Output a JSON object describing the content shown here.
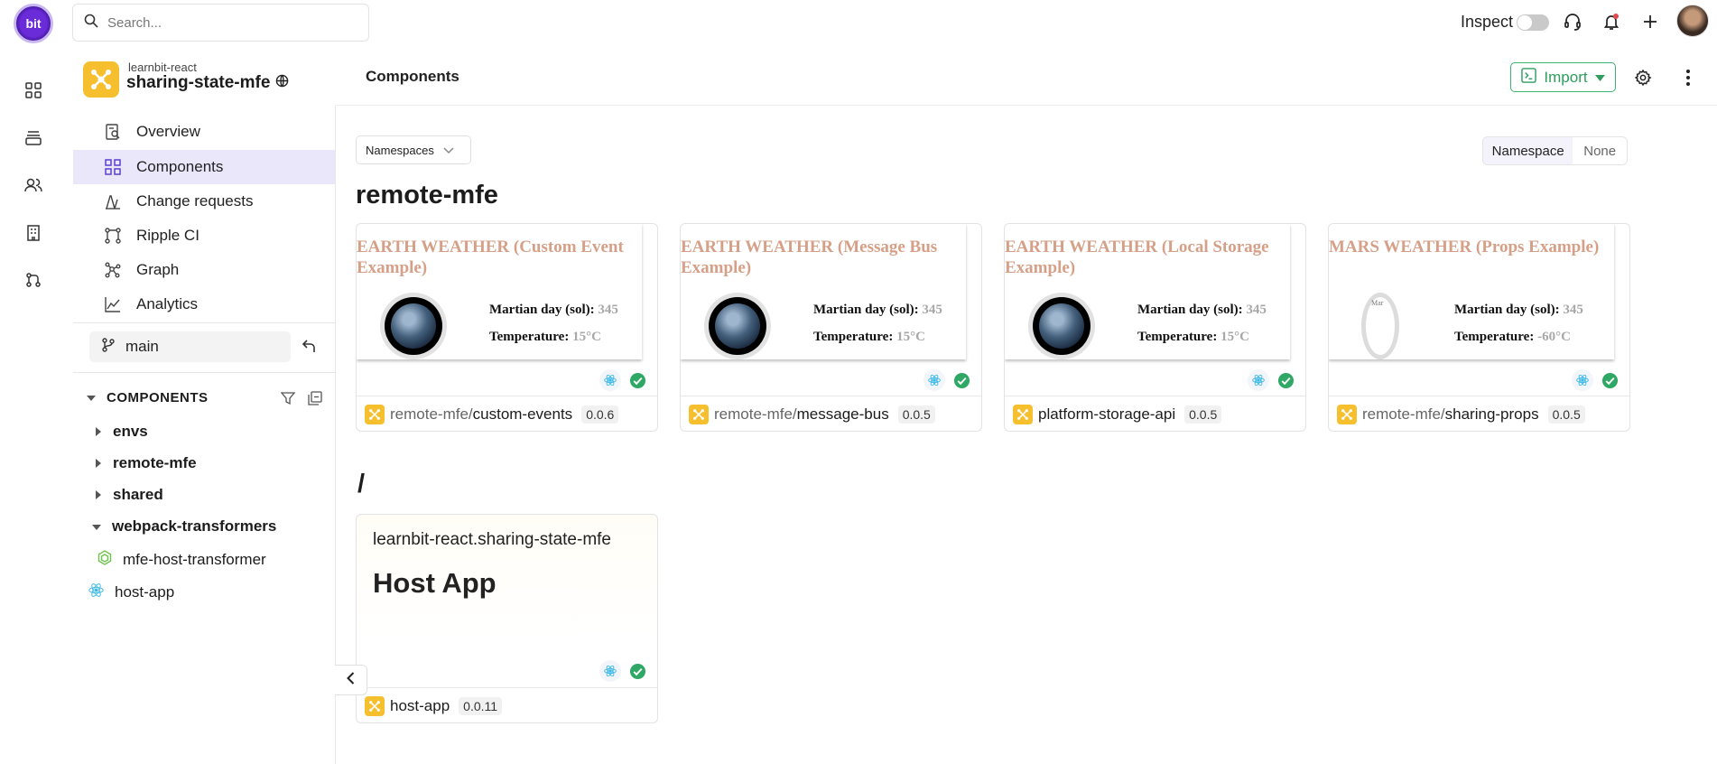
{
  "rail": {
    "logo_text": "bit",
    "icons": [
      "grid-icon",
      "layers-icon",
      "people-icon",
      "building-icon",
      "git-compare-icon"
    ]
  },
  "topbar": {
    "search_placeholder": "Search...",
    "inspect_label": "Inspect",
    "icons": [
      "support-icon",
      "notification-bell-icon",
      "plus-icon",
      "avatar"
    ]
  },
  "scope": {
    "owner": "learnbit-react",
    "name": "sharing-state-mfe",
    "brand_color": "#f6bf2e"
  },
  "header": {
    "title": "Components",
    "import_label": "Import",
    "accent_color": "#3cb371"
  },
  "sidebar": {
    "nav": [
      {
        "label": "Overview",
        "icon": "overview-icon"
      },
      {
        "label": "Components",
        "icon": "components-grid-icon",
        "active": true
      },
      {
        "label": "Change requests",
        "icon": "change-requests-icon"
      },
      {
        "label": "Ripple CI",
        "icon": "ripple-ci-icon"
      },
      {
        "label": "Graph",
        "icon": "graph-icon"
      },
      {
        "label": "Analytics",
        "icon": "analytics-icon"
      }
    ],
    "branch": "main",
    "components_heading": "COMPONENTS",
    "tree": [
      {
        "label": "envs",
        "type": "folder",
        "expanded": false
      },
      {
        "label": "remote-mfe",
        "type": "folder",
        "expanded": false
      },
      {
        "label": "shared",
        "type": "folder",
        "expanded": false
      },
      {
        "label": "webpack-transformers",
        "type": "folder",
        "expanded": true
      },
      {
        "label": "mfe-host-transformer",
        "type": "component",
        "icon": "node-env-icon"
      },
      {
        "label": "host-app",
        "type": "component",
        "icon": "react-icon"
      }
    ]
  },
  "main": {
    "namespace_dropdown": "Namespaces",
    "group_toggle": {
      "on": "Namespace",
      "off": "None"
    },
    "sections": [
      {
        "title": "remote-mfe",
        "cards": [
          {
            "preview_title": "EARTH WEATHER (Custom Event Example)",
            "planet": "earth",
            "sol_label": "Martian day (sol):",
            "sol": "345",
            "temp_label": "Temperature:",
            "temp": "15°C",
            "namespace": "remote-mfe/",
            "name": "custom-events",
            "version": "0.0.6"
          },
          {
            "preview_title": "EARTH WEATHER (Message Bus Example)",
            "planet": "earth",
            "sol_label": "Martian day (sol):",
            "sol": "345",
            "temp_label": "Temperature:",
            "temp": "15°C",
            "namespace": "remote-mfe/",
            "name": "message-bus",
            "version": "0.0.5"
          },
          {
            "preview_title": "EARTH WEATHER (Local Storage Example)",
            "planet": "earth",
            "sol_label": "Martian day (sol):",
            "sol": "345",
            "temp_label": "Temperature:",
            "temp": "15°C",
            "namespace": "",
            "name": "platform-storage-api",
            "version": "0.0.5"
          },
          {
            "preview_title": "MARS WEATHER (Props Example)",
            "planet": "mars",
            "mars_alt": "Mar",
            "sol_label": "Martian day (sol):",
            "sol": "345",
            "temp_label": "Temperature:",
            "temp": "-60°C",
            "namespace": "remote-mfe/",
            "name": "sharing-props",
            "version": "0.0.5"
          }
        ]
      },
      {
        "title": "/",
        "cards": [
          {
            "owner": "learnbit-react.sharing-state-mfe",
            "preview_title": "Host App",
            "name": "host-app",
            "version": "0.0.11"
          }
        ]
      }
    ]
  }
}
